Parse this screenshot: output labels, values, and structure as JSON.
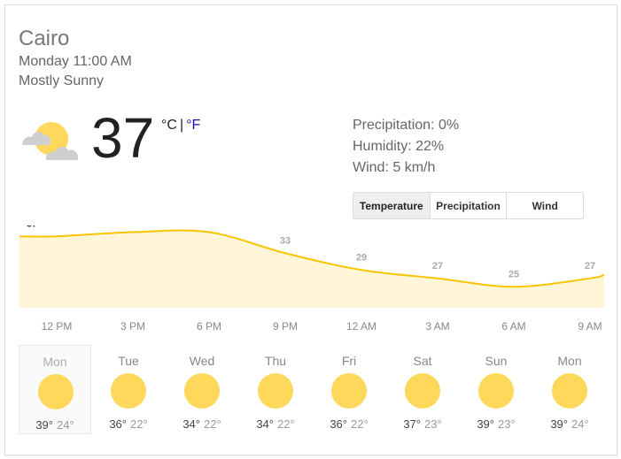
{
  "weather": {
    "city": "Cairo",
    "datetime": "Monday 11:00 AM",
    "condition": "Mostly Sunny",
    "temperature": "37",
    "unit_c": "°C",
    "unit_sep": "|",
    "unit_f": "°F",
    "precipitation": "Precipitation: 0%",
    "humidity": "Humidity: 22%",
    "wind": "Wind: 5 km/h",
    "current_icon": "partly-sunny-icon"
  },
  "tabs": [
    {
      "label": "Temperature",
      "active": true
    },
    {
      "label": "Precipitation",
      "active": false
    },
    {
      "label": "Wind",
      "active": false
    }
  ],
  "colors": {
    "line": "#f9c400",
    "fill": "#fef6d6",
    "sun": "#fdd85a",
    "link": "#1a0dab"
  },
  "chart_data": {
    "type": "area",
    "x": [
      "12 PM",
      "3 PM",
      "6 PM",
      "9 PM",
      "12 AM",
      "3 AM",
      "6 AM",
      "9 AM"
    ],
    "values": [
      37,
      38,
      38,
      33,
      29,
      27,
      25,
      27
    ],
    "unit": "°C"
  },
  "forecast": [
    {
      "day": "Mon",
      "hi": "39°",
      "lo": "24°",
      "icon": "sun-icon",
      "selected": true
    },
    {
      "day": "Tue",
      "hi": "36°",
      "lo": "22°",
      "icon": "sun-icon",
      "selected": false
    },
    {
      "day": "Wed",
      "hi": "34°",
      "lo": "22°",
      "icon": "sun-icon",
      "selected": false
    },
    {
      "day": "Thu",
      "hi": "34°",
      "lo": "22°",
      "icon": "sun-icon",
      "selected": false
    },
    {
      "day": "Fri",
      "hi": "36°",
      "lo": "22°",
      "icon": "sun-icon",
      "selected": false
    },
    {
      "day": "Sat",
      "hi": "37°",
      "lo": "23°",
      "icon": "sun-icon",
      "selected": false
    },
    {
      "day": "Sun",
      "hi": "39°",
      "lo": "23°",
      "icon": "sun-icon",
      "selected": false
    },
    {
      "day": "Mon",
      "hi": "39°",
      "lo": "24°",
      "icon": "sun-icon",
      "selected": false
    }
  ]
}
